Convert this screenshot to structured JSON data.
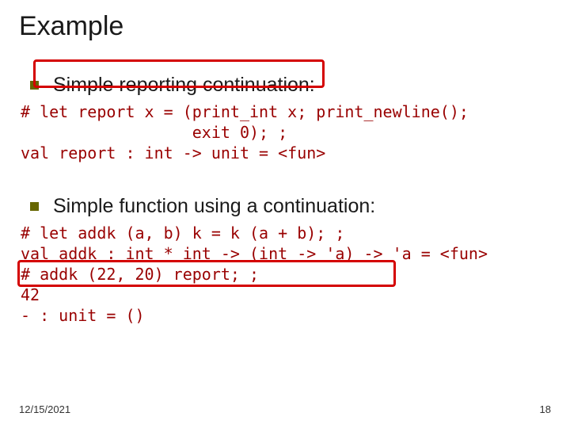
{
  "title": "Example",
  "bullet1": "Simple reporting continuation:",
  "code1": "# let report x = (print_int x; print_newline();\n                  exit 0); ;\nval report : int -> unit = <fun>",
  "bullet2": "Simple function using a continuation:",
  "code2": "# let addk (a, b) k = k (a + b); ;\nval addk : int * int -> (int -> 'a) -> 'a = <fun>\n# addk (22, 20) report; ;\n42\n- : unit = ()",
  "footer": {
    "date": "12/15/2021",
    "page": "18"
  }
}
